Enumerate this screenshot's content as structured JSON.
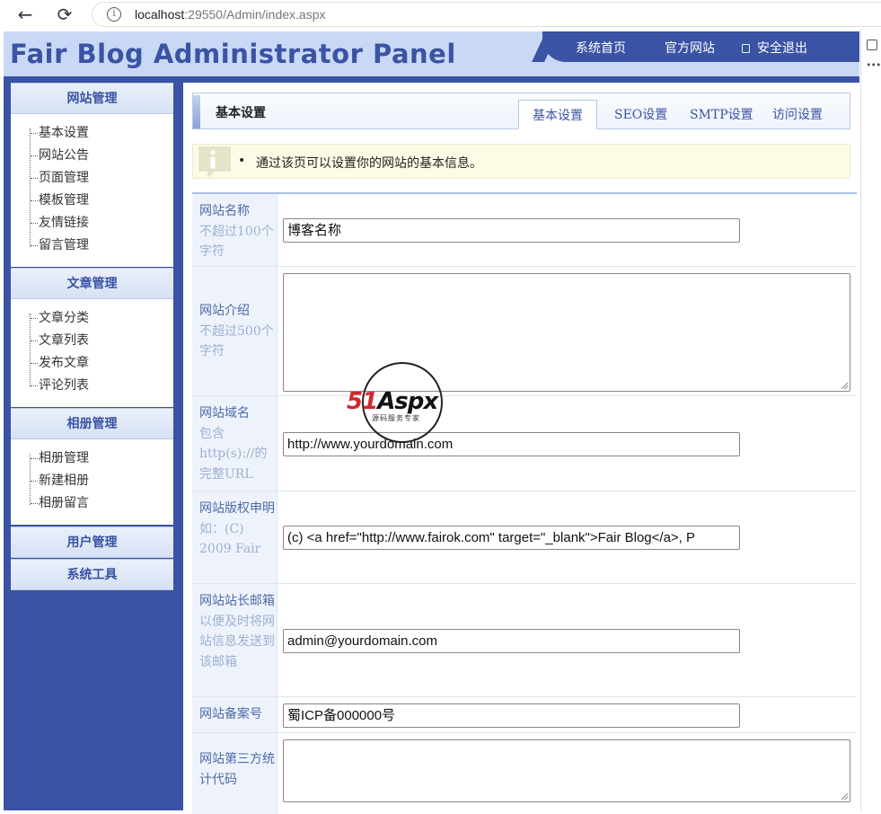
{
  "browser": {
    "host": "localhost",
    "path": ":29550/Admin/index.aspx"
  },
  "header": {
    "title": "Fair Blog Administrator Panel",
    "nav": [
      "系统首页",
      "官方网站",
      "安全退出"
    ]
  },
  "sidebar": {
    "groups": [
      {
        "title": "网站管理",
        "items": [
          "基本设置",
          "网站公告",
          "页面管理",
          "模板管理",
          "友情链接",
          "留言管理"
        ]
      },
      {
        "title": "文章管理",
        "items": [
          "文章分类",
          "文章列表",
          "发布文章",
          "评论列表"
        ]
      },
      {
        "title": "相册管理",
        "items": [
          "相册管理",
          "新建相册",
          "相册留言"
        ]
      },
      {
        "title": "用户管理",
        "items": []
      },
      {
        "title": "系统工具",
        "items": []
      }
    ]
  },
  "main": {
    "title": "基本设置",
    "tabs": [
      "基本设置",
      "SEO设置",
      "SMTP设置",
      "访问设置"
    ],
    "tip": "通过该页可以设置你的网站的基本信息。",
    "fields": [
      {
        "label": "网站名称",
        "sub": "不超过100个字符",
        "value": "博客名称"
      },
      {
        "label": "网站介绍",
        "sub": "不超过500个字符",
        "value": ""
      },
      {
        "label": "网站域名",
        "sub": "包含http(s)://的完整URL",
        "value": "http://www.yourdomain.com"
      },
      {
        "label": "网站版权申明",
        "sub": "如：(C) 2009 Fair",
        "value": "(c) <a href=\"http://www.fairok.com\" target=\"_blank\">Fair Blog</a>, P"
      },
      {
        "label": "网站站长邮箱",
        "sub": "以便及时将网站信息发送到该邮箱",
        "value": "admin@yourdomain.com"
      },
      {
        "label": "网站备案号",
        "sub": "",
        "value": "蜀ICP备000000号"
      },
      {
        "label": "网站第三方统计代码",
        "sub": "",
        "value": ""
      }
    ]
  },
  "watermark": {
    "brand": "51Aspx",
    "tagline": "源码服务专家"
  },
  "colors": {
    "brand_blue": "#3a53a4",
    "header_light": "#c9d9f5",
    "label_bg": "#eef3fb",
    "tip_bg": "#fdfbe6"
  }
}
